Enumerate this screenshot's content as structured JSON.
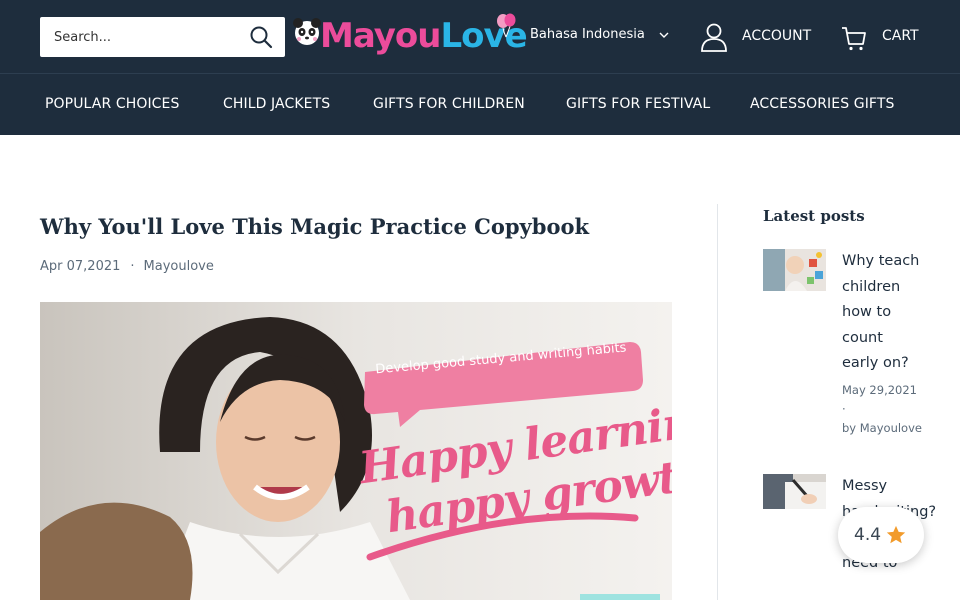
{
  "header": {
    "search_placeholder": "Search...",
    "logo": {
      "part1": "Mayou",
      "part2": "Love"
    },
    "language": "Bahasa Indonesia",
    "account_label": "ACCOUNT",
    "cart_label": "CART"
  },
  "nav": {
    "items": [
      {
        "label": "POPULAR CHOICES"
      },
      {
        "label": "CHILD JACKETS"
      },
      {
        "label": "GIFTS FOR CHILDREN"
      },
      {
        "label": "GIFTS FOR FESTIVAL"
      },
      {
        "label": "ACCESSORIES GIFTS"
      }
    ]
  },
  "article": {
    "title": "Why You'll Love This Magic Practice Copybook",
    "date": "Apr 07,2021",
    "separator": "·",
    "author": "Mayoulove",
    "image": {
      "banner_text": "Develop good study and writing habits",
      "headline_line1": "Happy learning",
      "headline_line2": "happy growth"
    }
  },
  "sidebar": {
    "title": "Latest posts",
    "posts": [
      {
        "title": "Why teach children how to count early on?",
        "date": "May 29,2021",
        "separator": "·",
        "byline": "by Mayoulove"
      },
      {
        "title": "Messy handwriting? What you need to"
      }
    ]
  },
  "rating": {
    "value": "4.4"
  },
  "colors": {
    "header_bg": "#1e2d3d",
    "brand_pink": "#ec4c9b",
    "brand_blue": "#2ab5e6",
    "star": "#f29b2b"
  }
}
